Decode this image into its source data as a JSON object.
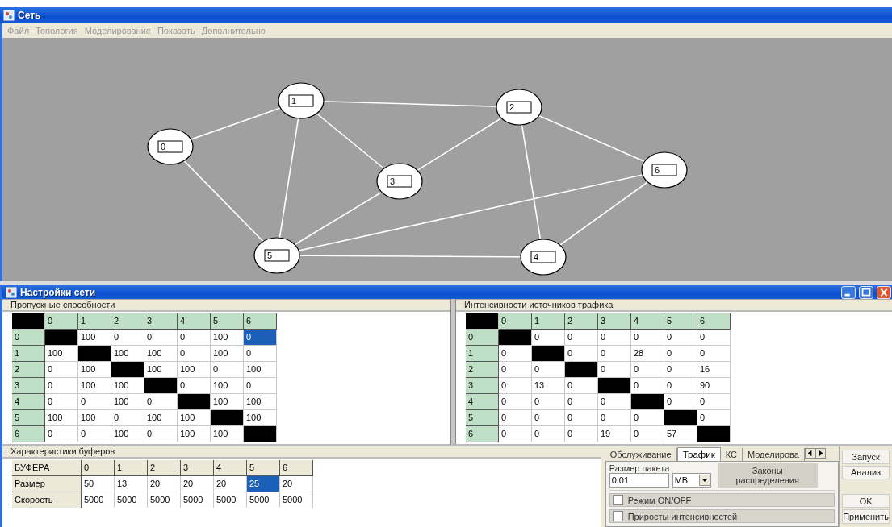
{
  "main_window": {
    "title": "Сеть"
  },
  "menu": [
    "Файл",
    "Топология",
    "Моделирование",
    "Показать",
    "Дополнительно"
  ],
  "network": {
    "nodes": [
      "0",
      "1",
      "2",
      "3",
      "4",
      "5",
      "6"
    ]
  },
  "settings_window": {
    "title": "Настройки сети"
  },
  "capacity": {
    "title": "Пропускные способности",
    "columns": [
      "0",
      "1",
      "2",
      "3",
      "4",
      "5",
      "6"
    ],
    "rows": [
      {
        "header": "0",
        "cells": [
          {
            "kind": "blocked"
          },
          {
            "kind": "value",
            "value": "100",
            "selected": false
          },
          {
            "kind": "value",
            "value": "0",
            "selected": false
          },
          {
            "kind": "value",
            "value": "0",
            "selected": false
          },
          {
            "kind": "value",
            "value": "0",
            "selected": false
          },
          {
            "kind": "value",
            "value": "100",
            "selected": false
          },
          {
            "kind": "value",
            "value": "0",
            "selected": true
          }
        ]
      },
      {
        "header": "1",
        "cells": [
          {
            "kind": "value",
            "value": "100",
            "selected": false
          },
          {
            "kind": "blocked"
          },
          {
            "kind": "value",
            "value": "100",
            "selected": false
          },
          {
            "kind": "value",
            "value": "100",
            "selected": false
          },
          {
            "kind": "value",
            "value": "0",
            "selected": false
          },
          {
            "kind": "value",
            "value": "100",
            "selected": false
          },
          {
            "kind": "value",
            "value": "0",
            "selected": false
          }
        ]
      },
      {
        "header": "2",
        "cells": [
          {
            "kind": "value",
            "value": "0",
            "selected": false
          },
          {
            "kind": "value",
            "value": "100",
            "selected": false
          },
          {
            "kind": "blocked"
          },
          {
            "kind": "value",
            "value": "100",
            "selected": false
          },
          {
            "kind": "value",
            "value": "100",
            "selected": false
          },
          {
            "kind": "value",
            "value": "0",
            "selected": false
          },
          {
            "kind": "value",
            "value": "100",
            "selected": false
          }
        ]
      },
      {
        "header": "3",
        "cells": [
          {
            "kind": "value",
            "value": "0",
            "selected": false
          },
          {
            "kind": "value",
            "value": "100",
            "selected": false
          },
          {
            "kind": "value",
            "value": "100",
            "selected": false
          },
          {
            "kind": "blocked"
          },
          {
            "kind": "value",
            "value": "0",
            "selected": false
          },
          {
            "kind": "value",
            "value": "100",
            "selected": false
          },
          {
            "kind": "value",
            "value": "0",
            "selected": false
          }
        ]
      },
      {
        "header": "4",
        "cells": [
          {
            "kind": "value",
            "value": "0",
            "selected": false
          },
          {
            "kind": "value",
            "value": "0",
            "selected": false
          },
          {
            "kind": "value",
            "value": "100",
            "selected": false
          },
          {
            "kind": "value",
            "value": "0",
            "selected": false
          },
          {
            "kind": "blocked"
          },
          {
            "kind": "value",
            "value": "100",
            "selected": false
          },
          {
            "kind": "value",
            "value": "100",
            "selected": false
          }
        ]
      },
      {
        "header": "5",
        "cells": [
          {
            "kind": "value",
            "value": "100",
            "selected": false
          },
          {
            "kind": "value",
            "value": "100",
            "selected": false
          },
          {
            "kind": "value",
            "value": "0",
            "selected": false
          },
          {
            "kind": "value",
            "value": "100",
            "selected": false
          },
          {
            "kind": "value",
            "value": "100",
            "selected": false
          },
          {
            "kind": "blocked"
          },
          {
            "kind": "value",
            "value": "100",
            "selected": false
          }
        ]
      },
      {
        "header": "6",
        "cells": [
          {
            "kind": "value",
            "value": "0",
            "selected": false
          },
          {
            "kind": "value",
            "value": "0",
            "selected": false
          },
          {
            "kind": "value",
            "value": "100",
            "selected": false
          },
          {
            "kind": "value",
            "value": "0",
            "selected": false
          },
          {
            "kind": "value",
            "value": "100",
            "selected": false
          },
          {
            "kind": "value",
            "value": "100",
            "selected": false
          },
          {
            "kind": "blocked"
          }
        ]
      }
    ]
  },
  "traffic": {
    "title": "Интенсивности источников трафика",
    "columns": [
      "0",
      "1",
      "2",
      "3",
      "4",
      "5",
      "6"
    ],
    "rows": [
      {
        "header": "0",
        "cells": [
          {
            "kind": "blocked"
          },
          {
            "kind": "value",
            "value": "0",
            "selected": false
          },
          {
            "kind": "value",
            "value": "0",
            "selected": false
          },
          {
            "kind": "value",
            "value": "0",
            "selected": false
          },
          {
            "kind": "value",
            "value": "0",
            "selected": false
          },
          {
            "kind": "value",
            "value": "0",
            "selected": false
          },
          {
            "kind": "value",
            "value": "0",
            "selected": false
          }
        ]
      },
      {
        "header": "1",
        "cells": [
          {
            "kind": "value",
            "value": "0",
            "selected": false
          },
          {
            "kind": "blocked"
          },
          {
            "kind": "value",
            "value": "0",
            "selected": false
          },
          {
            "kind": "value",
            "value": "0",
            "selected": false
          },
          {
            "kind": "value",
            "value": "28",
            "selected": false
          },
          {
            "kind": "value",
            "value": "0",
            "selected": false
          },
          {
            "kind": "value",
            "value": "0",
            "selected": false
          }
        ]
      },
      {
        "header": "2",
        "cells": [
          {
            "kind": "value",
            "value": "0",
            "selected": false
          },
          {
            "kind": "value",
            "value": "0",
            "selected": false
          },
          {
            "kind": "blocked"
          },
          {
            "kind": "value",
            "value": "0",
            "selected": false
          },
          {
            "kind": "value",
            "value": "0",
            "selected": false
          },
          {
            "kind": "value",
            "value": "0",
            "selected": false
          },
          {
            "kind": "value",
            "value": "16",
            "selected": false
          }
        ]
      },
      {
        "header": "3",
        "cells": [
          {
            "kind": "value",
            "value": "0",
            "selected": false
          },
          {
            "kind": "value",
            "value": "13",
            "selected": false
          },
          {
            "kind": "value",
            "value": "0",
            "selected": false
          },
          {
            "kind": "blocked"
          },
          {
            "kind": "value",
            "value": "0",
            "selected": false
          },
          {
            "kind": "value",
            "value": "0",
            "selected": false
          },
          {
            "kind": "value",
            "value": "90",
            "selected": false
          }
        ]
      },
      {
        "header": "4",
        "cells": [
          {
            "kind": "value",
            "value": "0",
            "selected": false
          },
          {
            "kind": "value",
            "value": "0",
            "selected": false
          },
          {
            "kind": "value",
            "value": "0",
            "selected": false
          },
          {
            "kind": "value",
            "value": "0",
            "selected": false
          },
          {
            "kind": "blocked"
          },
          {
            "kind": "value",
            "value": "0",
            "selected": false
          },
          {
            "kind": "value",
            "value": "0",
            "selected": false
          }
        ]
      },
      {
        "header": "5",
        "cells": [
          {
            "kind": "value",
            "value": "0",
            "selected": false
          },
          {
            "kind": "value",
            "value": "0",
            "selected": false
          },
          {
            "kind": "value",
            "value": "0",
            "selected": false
          },
          {
            "kind": "value",
            "value": "0",
            "selected": false
          },
          {
            "kind": "value",
            "value": "0",
            "selected": false
          },
          {
            "kind": "blocked"
          },
          {
            "kind": "value",
            "value": "0",
            "selected": false
          }
        ]
      },
      {
        "header": "6",
        "cells": [
          {
            "kind": "value",
            "value": "0",
            "selected": false
          },
          {
            "kind": "value",
            "value": "0",
            "selected": false
          },
          {
            "kind": "value",
            "value": "0",
            "selected": false
          },
          {
            "kind": "value",
            "value": "19",
            "selected": false
          },
          {
            "kind": "value",
            "value": "0",
            "selected": false
          },
          {
            "kind": "value",
            "value": "57",
            "selected": false
          },
          {
            "kind": "blocked"
          }
        ]
      }
    ]
  },
  "buffers": {
    "title": "Характеристики буферов",
    "corner": "БУФЕРА",
    "columns": [
      "0",
      "1",
      "2",
      "3",
      "4",
      "5",
      "6"
    ],
    "rows": [
      {
        "header": "Размер",
        "cells": [
          {
            "value": "50",
            "selected": false
          },
          {
            "value": "13",
            "selected": false
          },
          {
            "value": "20",
            "selected": false
          },
          {
            "value": "20",
            "selected": false
          },
          {
            "value": "20",
            "selected": false
          },
          {
            "value": "25",
            "selected": true
          },
          {
            "value": "20",
            "selected": false
          }
        ]
      },
      {
        "header": "Скорость",
        "cells": [
          {
            "value": "5000",
            "selected": false
          },
          {
            "value": "5000",
            "selected": false
          },
          {
            "value": "5000",
            "selected": false
          },
          {
            "value": "5000",
            "selected": false
          },
          {
            "value": "5000",
            "selected": false
          },
          {
            "value": "5000",
            "selected": false
          },
          {
            "value": "5000",
            "selected": false
          }
        ]
      }
    ]
  },
  "tabs": [
    {
      "label": "Обслуживание",
      "selected": false
    },
    {
      "label": "Трафик",
      "selected": true
    },
    {
      "label": "КС",
      "selected": false
    },
    {
      "label": "Моделирова",
      "selected": false
    }
  ],
  "packet": {
    "label": "Размер пакета",
    "value": "0,01",
    "unit": "MB",
    "laws_button": [
      "Законы",
      "распределения"
    ]
  },
  "options": [
    {
      "label": "Режим ON/OFF",
      "checked": false
    },
    {
      "label": "Приросты интенсивностей",
      "checked": false
    }
  ],
  "side_buttons": [
    {
      "label": "Запуск"
    },
    {
      "label": "Анализ"
    },
    {
      "label": "OK"
    },
    {
      "label": "Применить"
    }
  ]
}
